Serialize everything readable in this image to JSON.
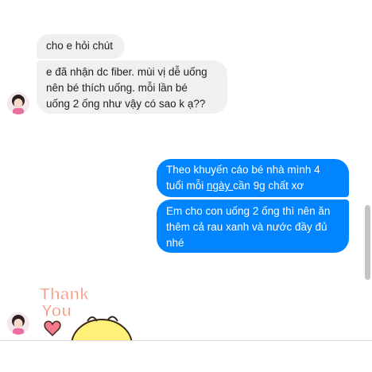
{
  "messages": [
    {
      "sender": "contact",
      "text": "cho e hỏi chút"
    },
    {
      "sender": "contact",
      "line1": "e đã nhận dc fiber. mùi vị dễ uống",
      "line2": "nên bé thích uống. mỗi lần bé",
      "line3": "uống 2 ống như vậy có sao k ạ??"
    },
    {
      "sender": "me",
      "line1": "Theo khuyến cáo bé nhà mình 4",
      "line2_pre": "tuổi mỗi ",
      "line2_link": "ngày ",
      "line2_post": "cần 9g chất xơ"
    },
    {
      "sender": "me",
      "line1": "Em cho con uống 2 ống thì nên ăn",
      "line2": "thêm cả rau xanh và nước đầy đủ",
      "line3": "nhé"
    }
  ],
  "sticker": {
    "text_line1": "Thank",
    "text_line2": "You"
  },
  "colors": {
    "outgoing": "#0084ff",
    "incoming": "#f1f0f0",
    "sticker_text": "#f6a08c",
    "sticker_body": "#fff07a"
  }
}
